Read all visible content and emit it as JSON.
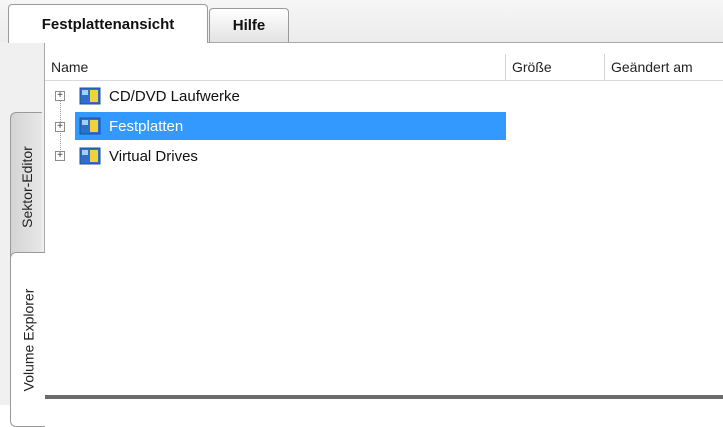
{
  "tabs": [
    {
      "label": "Festplattenansicht",
      "active": true
    },
    {
      "label": "Hilfe",
      "active": false
    }
  ],
  "side_tabs": [
    {
      "label": "Sektor-Editor",
      "active": false
    },
    {
      "label": "Volume Explorer",
      "active": true
    }
  ],
  "columns": {
    "name": "Name",
    "size": "Größe",
    "modified": "Geändert am"
  },
  "tree": [
    {
      "label": "CD/DVD Laufwerke",
      "icon": "drive-icon",
      "selected": false
    },
    {
      "label": "Festplatten",
      "icon": "drive-icon",
      "selected": true
    },
    {
      "label": "Virtual Drives",
      "icon": "drive-icon",
      "selected": false
    }
  ],
  "colors": {
    "selection": "#3399ff",
    "icon_blue": "#2f6fc9",
    "icon_yellow": "#f2d23a"
  }
}
